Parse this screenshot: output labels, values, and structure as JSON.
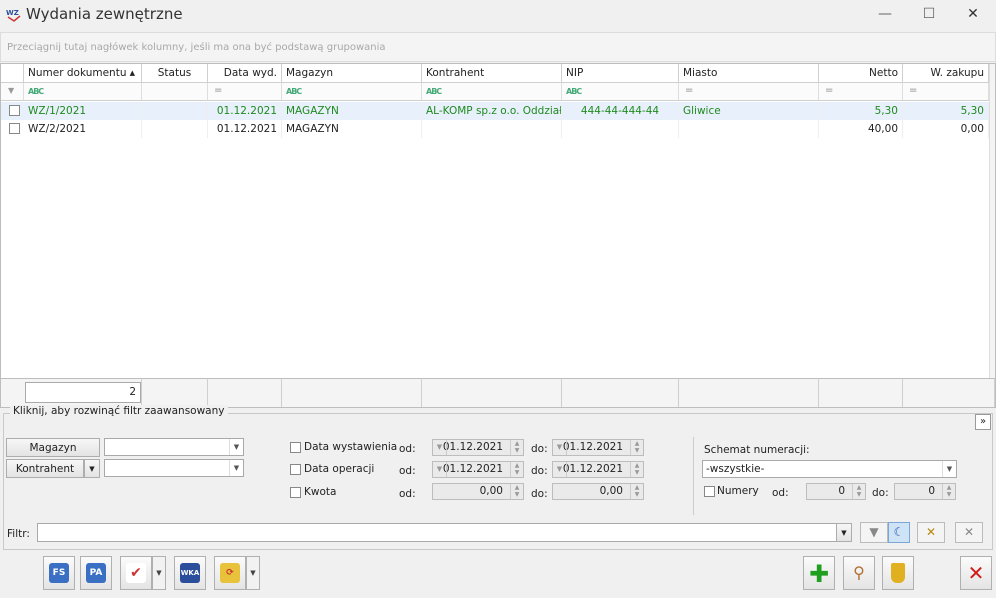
{
  "window": {
    "title": "Wydania zewnętrzne",
    "minimize": "—",
    "maximize": "☐",
    "close": "✕"
  },
  "grouping_hint": "Przeciągnij tutaj nagłówek kolumny, jeśli ma ona być podstawą grupowania",
  "grid": {
    "columns": [
      "Numer dokumentu",
      "Status",
      "Data wyd.",
      "Magazyn",
      "Kontrahent",
      "NIP",
      "Miasto",
      "Netto",
      "W. zakupu"
    ],
    "filter_abc": "ABC",
    "filter_eq": "=",
    "rows": [
      {
        "numer": "WZ/1/2021",
        "status": "",
        "data": "01.12.2021",
        "magazyn": "MAGAZYN",
        "kontrahent": "AL-KOMP sp.z o.o. Oddział ...",
        "nip": "444-44-444-44",
        "miasto": "Gliwice",
        "netto": "5,30",
        "zakup": "5,30"
      },
      {
        "numer": "WZ/2/2021",
        "status": "",
        "data": "01.12.2021",
        "magazyn": "MAGAZYN",
        "kontrahent": "",
        "nip": "",
        "miasto": "",
        "netto": "40,00",
        "zakup": "0,00"
      }
    ],
    "count": "2"
  },
  "filter_panel": {
    "title": "Kliknij, aby rozwinąć filtr zaawansowany",
    "magazyn_btn": "Magazyn",
    "kontrahent_btn": "Kontrahent",
    "data_wystawienia": "Data wystawienia",
    "data_operacji": "Data operacji",
    "kwota": "Kwota",
    "od": "od:",
    "do": "do:",
    "dw_od": "01.12.2021",
    "dw_do": "01.12.2021",
    "do_od": "01.12.2021",
    "do_do": "01.12.2021",
    "kw_od": "0,00",
    "kw_do": "0,00",
    "schemat_label": "Schemat numeracji:",
    "schemat_value": "-wszystkie-",
    "numery": "Numery",
    "num_od": "0",
    "num_do": "0",
    "filtr_label": "Filtr:"
  },
  "toolbar": {
    "fs": "FS",
    "pa": "PA",
    "wka": "WKA"
  },
  "colors": {
    "accent_green": "#1e8a1e",
    "selected_row": "#e8f0fb",
    "close_red": "#d11a1a"
  }
}
